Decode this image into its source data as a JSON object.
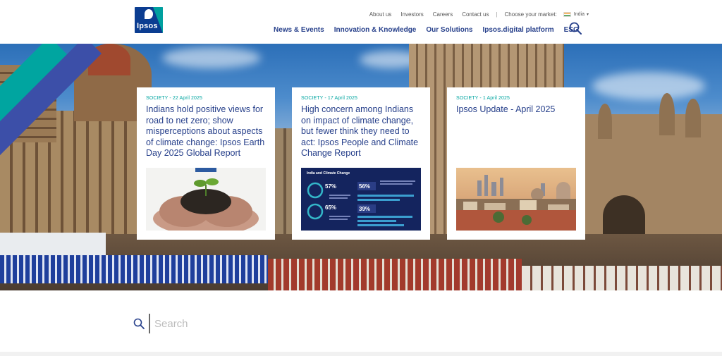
{
  "header": {
    "logo_text": "Ipsos",
    "util_links": [
      "About us",
      "Investors",
      "Careers",
      "Contact us"
    ],
    "separator": "|",
    "market_label": "Choose your market:",
    "market_value": "India",
    "main_nav": [
      "News & Events",
      "Innovation & Knowledge",
      "Our Solutions",
      "Ipsos.digital platform",
      "ESG"
    ]
  },
  "cards": [
    {
      "meta": "SOCIETY - 22 April 2025",
      "title": "Indians hold positive views for road to net zero; show misperceptions about aspects of climate change: Ipsos Earth Day 2025 Global Report"
    },
    {
      "meta": "SOCIETY - 17 April 2025",
      "title": "High concern among Indians on impact of climate change, but fewer think they need to act: Ipsos People and Climate Change Report",
      "thumb": {
        "heading": "India and Climate Change",
        "stats": [
          "57%",
          "56%",
          "65%",
          "39%"
        ]
      }
    },
    {
      "meta": "SOCIETY - 1 April 2025",
      "title": "Ipsos Update - April 2025"
    }
  ],
  "search": {
    "placeholder": "Search"
  },
  "colors": {
    "brand_blue": "#27408b",
    "teal": "#00a5a0",
    "logo_blue": "#0b3d91"
  }
}
